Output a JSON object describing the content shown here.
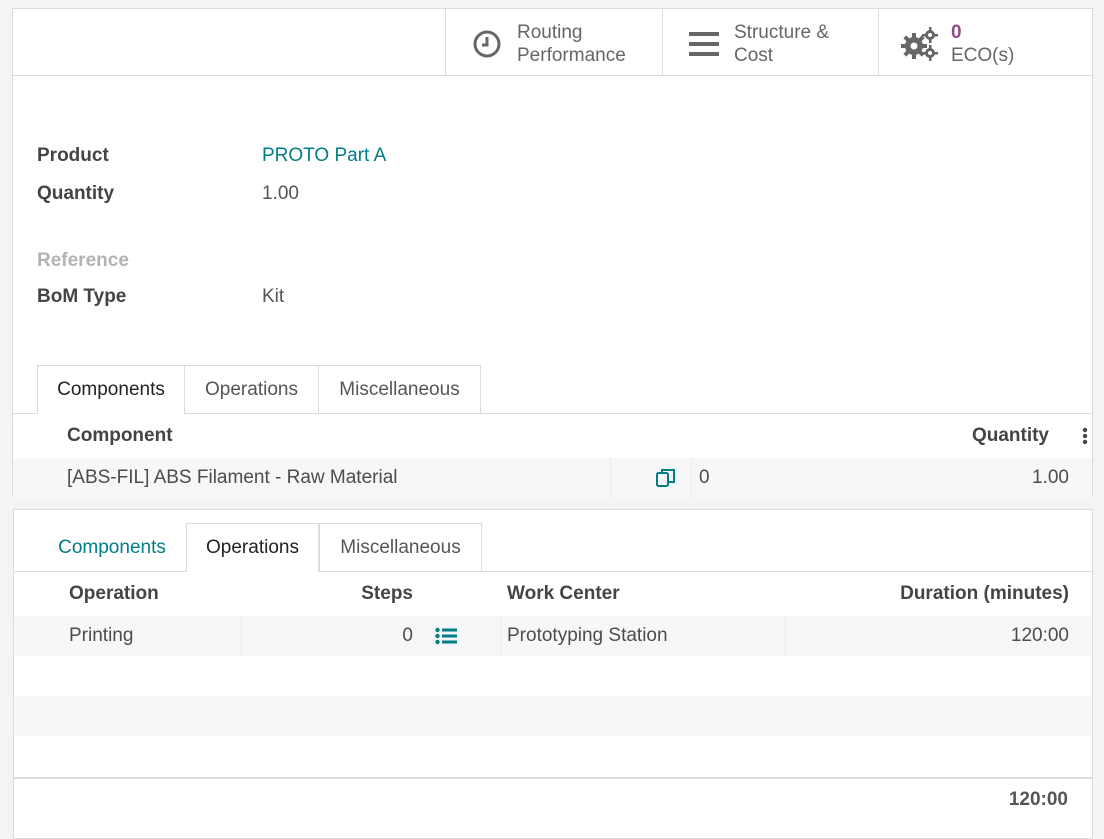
{
  "smart_buttons": {
    "routing": {
      "line1": "Routing",
      "line2": "Performance"
    },
    "structure": {
      "line1": "Structure &",
      "line2": "Cost"
    },
    "eco": {
      "count": "0",
      "label": "ECO(s)"
    }
  },
  "form": {
    "product_label": "Product",
    "product_value": "PROTO Part A",
    "quantity_label": "Quantity",
    "quantity_value": "1.00",
    "reference_label": "Reference",
    "bom_type_label": "BoM Type",
    "bom_type_value": "Kit"
  },
  "tabs_top": [
    "Components",
    "Operations",
    "Miscellaneous"
  ],
  "components_table": {
    "headers": {
      "component": "Component",
      "quantity": "Quantity"
    },
    "rows": [
      {
        "component": "[ABS-FIL] ABS Filament - Raw Material",
        "count": "0",
        "quantity": "1.00"
      }
    ]
  },
  "tabs_bottom": [
    "Components",
    "Operations",
    "Miscellaneous"
  ],
  "operations_table": {
    "headers": {
      "operation": "Operation",
      "steps": "Steps",
      "work_center": "Work Center",
      "duration": "Duration (minutes)"
    },
    "rows": [
      {
        "operation": "Printing",
        "steps": "0",
        "work_center": "Prototyping Station",
        "duration": "120:00"
      }
    ],
    "total": "120:00"
  },
  "colors": {
    "accent": "#017e84",
    "eco": "#8f4c86"
  },
  "icons": {
    "routing": "clock-icon",
    "structure": "bars-icon",
    "eco": "gears-icon",
    "copy": "copy-icon",
    "steps": "list-icon",
    "menu": "vertical-dots-icon"
  }
}
